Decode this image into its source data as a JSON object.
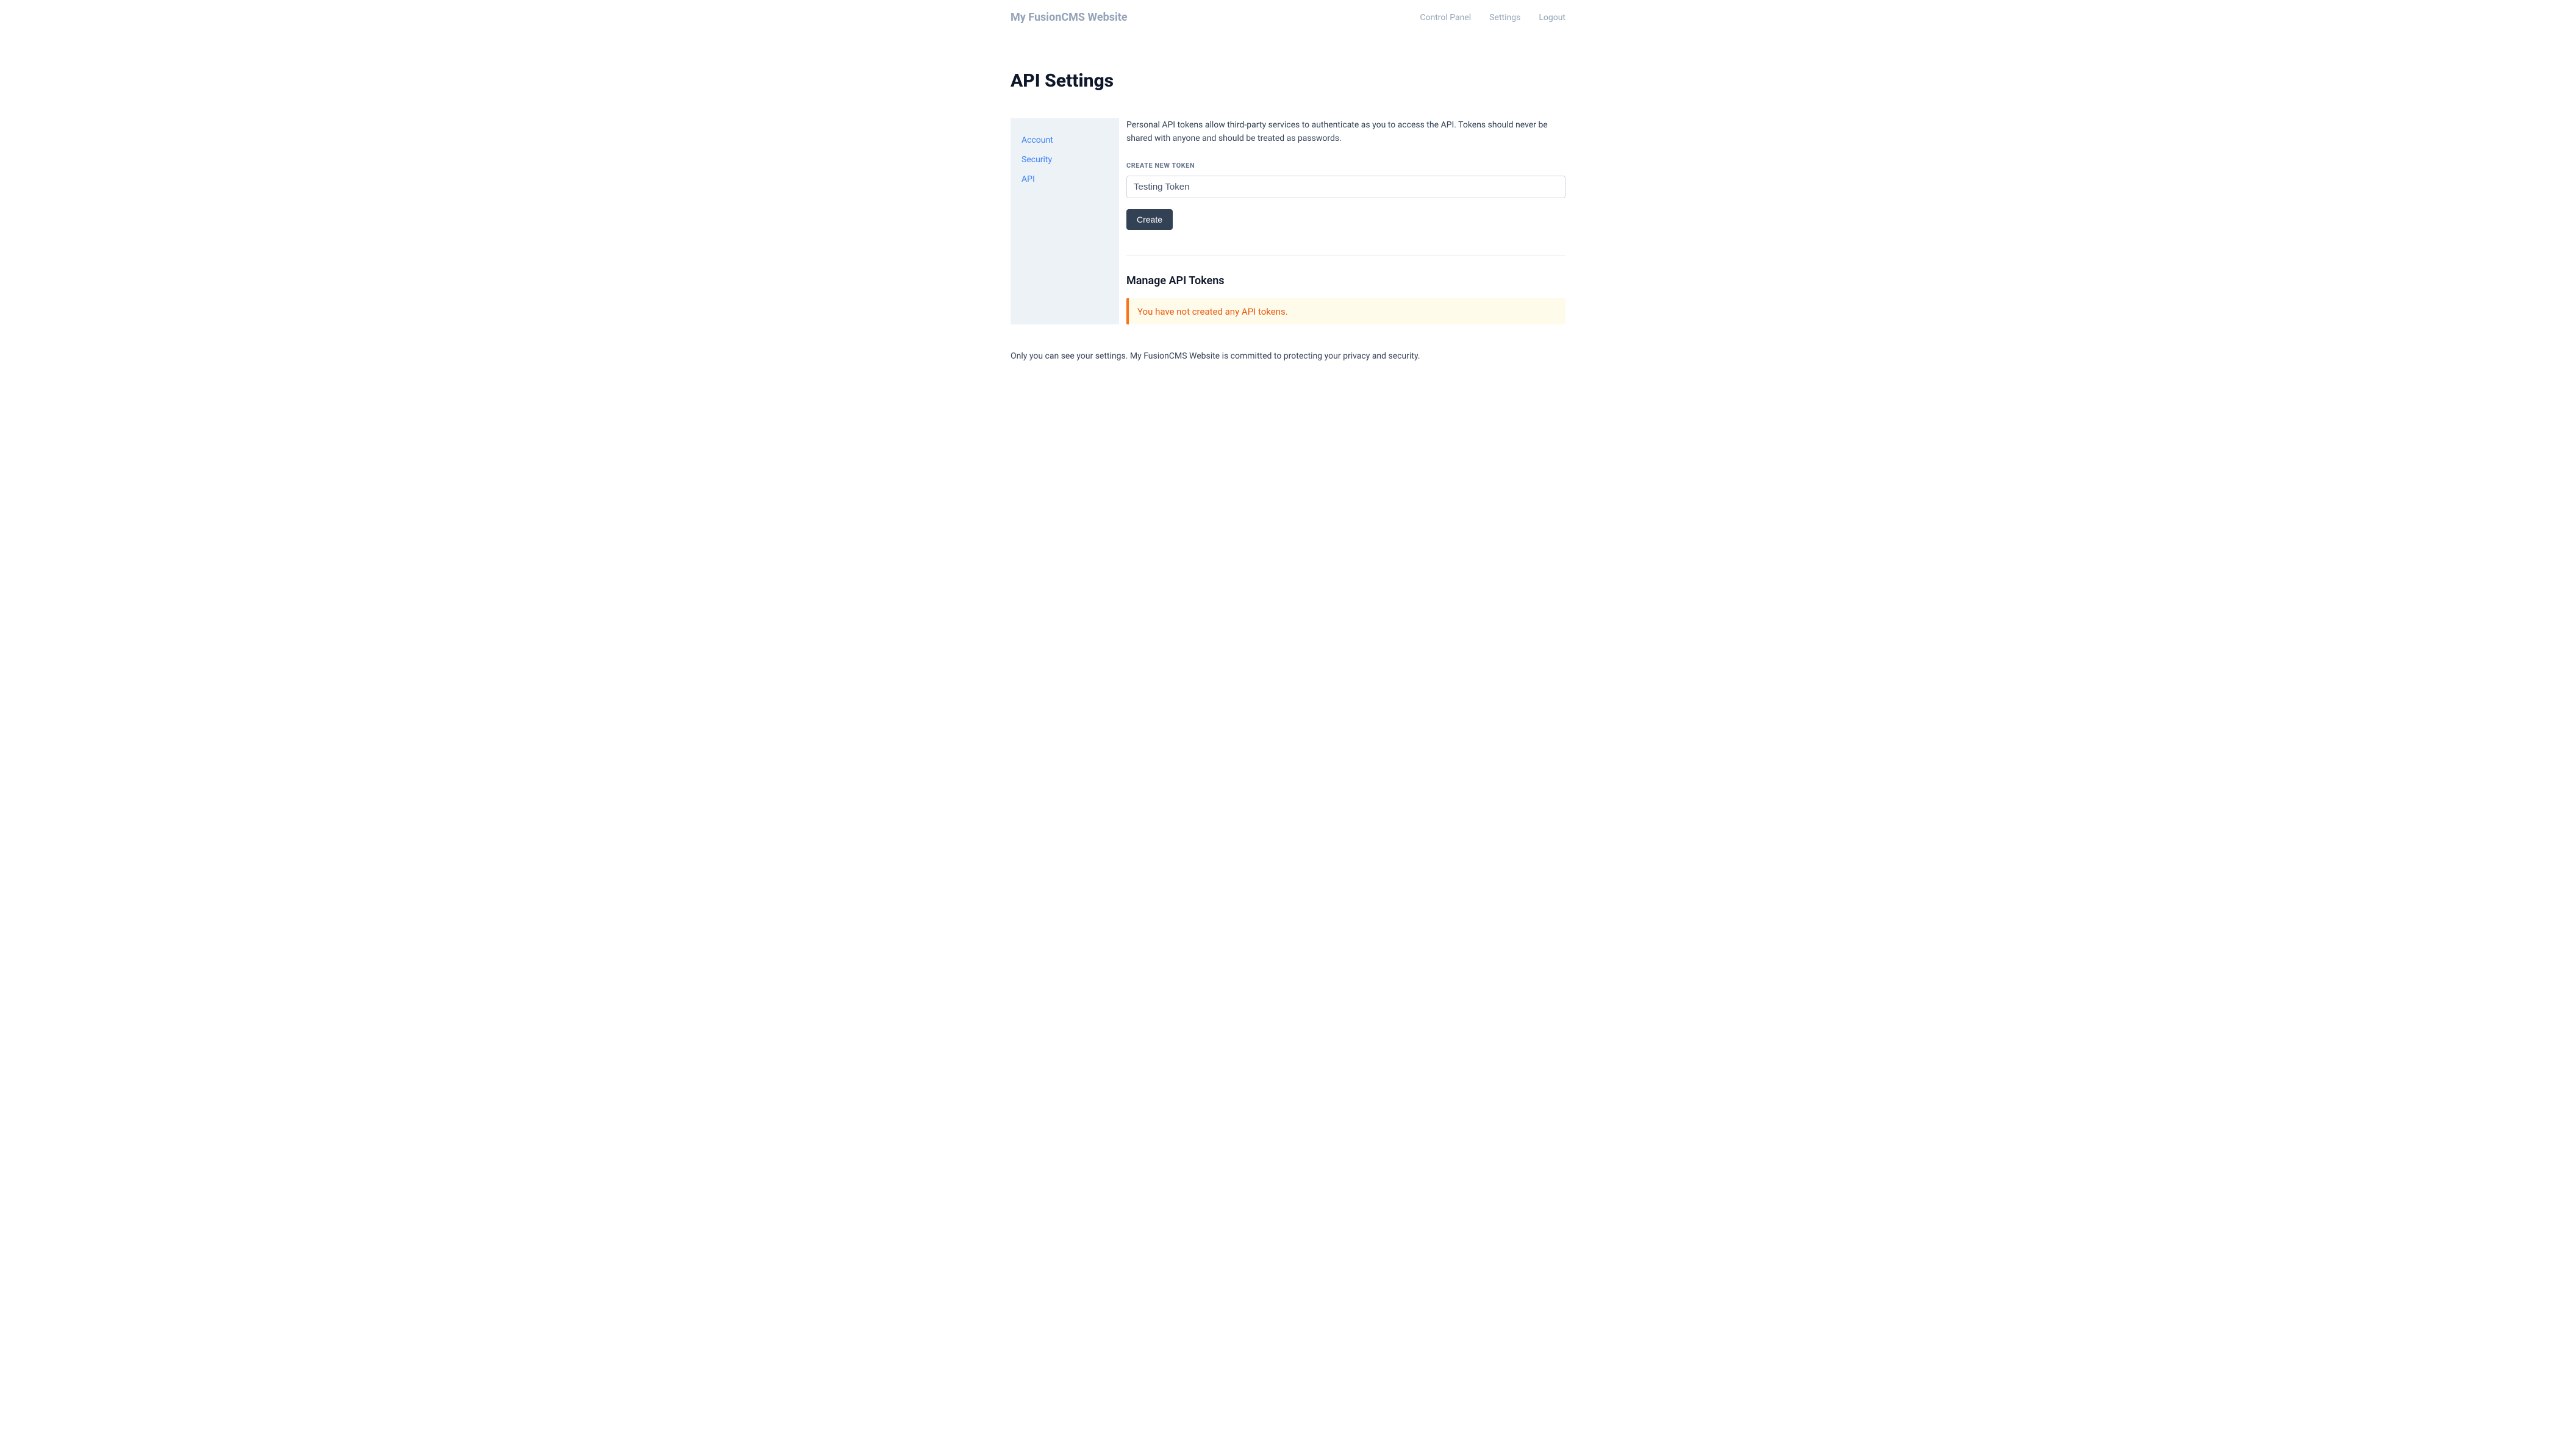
{
  "header": {
    "site_title": "My FusionCMS Website",
    "nav": {
      "control_panel": "Control Panel",
      "settings": "Settings",
      "logout": "Logout"
    }
  },
  "page_title": "API Settings",
  "sidebar": {
    "items": [
      {
        "label": "Account"
      },
      {
        "label": "Security"
      },
      {
        "label": "API"
      }
    ]
  },
  "main": {
    "intro_text": "Personal API tokens allow third-party services to authenticate as you to access the API. Tokens should never be shared with anyone and should be treated as passwords.",
    "create_section": {
      "label": "CREATE NEW TOKEN",
      "input_value": "Testing Token",
      "button_label": "Create"
    },
    "manage_section": {
      "title": "Manage API Tokens",
      "empty_message": "You have not created any API tokens."
    }
  },
  "footer": {
    "text": "Only you can see your settings. My FusionCMS Website is committed to protecting your privacy and security."
  }
}
